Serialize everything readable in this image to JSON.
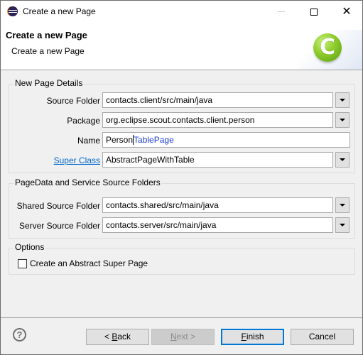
{
  "window": {
    "title": "Create a new Page",
    "controls": {
      "minimize": "minimize",
      "maximize": "maximize",
      "close": "close"
    }
  },
  "header": {
    "title": "Create a new Page",
    "description": "Create a new Page",
    "logo_glyph": "C"
  },
  "groups": {
    "details": {
      "legend": "New Page Details",
      "source_folder": {
        "label": "Source Folder",
        "value": "contacts.client/src/main/java"
      },
      "package": {
        "label": "Package",
        "value": "org.eclipse.scout.contacts.client.person"
      },
      "name": {
        "label": "Name",
        "typed": "Person",
        "completion": "TablePage"
      },
      "super_class": {
        "label": "Super Class",
        "value": "AbstractPageWithTable"
      }
    },
    "folders": {
      "legend": "PageData and Service Source Folders",
      "shared": {
        "label": "Shared Source Folder",
        "value": "contacts.shared/src/main/java"
      },
      "server": {
        "label": "Server Source Folder",
        "value": "contacts.server/src/main/java"
      }
    },
    "options": {
      "legend": "Options",
      "abstract_super_page": {
        "label": "Create an Abstract Super Page",
        "checked": false
      }
    }
  },
  "footer": {
    "help_glyph": "?",
    "back": {
      "prefix": "< ",
      "mnemonic": "B",
      "rest": "ack"
    },
    "next": {
      "mnemonic": "N",
      "rest": "ext >"
    },
    "finish": {
      "mnemonic": "F",
      "rest": "inish"
    },
    "cancel": "Cancel"
  },
  "colors": {
    "link": "#0066cc",
    "completion_text": "#1f3fd6",
    "default_button_border": "#0078d7",
    "logo_green": "#8ccc2a"
  }
}
